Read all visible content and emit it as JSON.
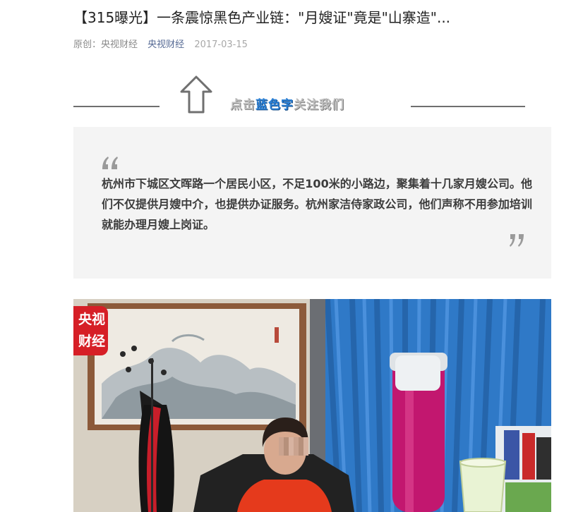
{
  "article": {
    "title": "【315曝光】一条震惊黑色产业链：\"月嫂证\"竟是\"山寨造\"...",
    "author": "原创：央视财经",
    "account": "央视财经",
    "date": "2017-03-15"
  },
  "follow_banner": {
    "prefix": "点击",
    "highlight": "蓝色字",
    "suffix": "关注我们",
    "icon": "up-arrow-icon"
  },
  "quote": {
    "text": "杭州市下城区文晖路一个居民小区，不足100米的小路边，聚集着十几家月嫂公司。他们不仅提供月嫂中介，也提供办证服务。杭州家洁侍家政公司，他们声称不用参加培训就能办理月嫂上岗证。",
    "open_icon": "open-quote-icon",
    "close_icon": "close-quote-icon"
  },
  "video": {
    "logo_line1": "央视",
    "logo_line2": "财经",
    "colors": {
      "logo": "#d61f26",
      "curtain": "#2f79c7",
      "thermos": "#c2176f",
      "jacket": "#e53a1c"
    }
  },
  "colors": {
    "account_link": "#576b95",
    "highlight": "#2a7fd4"
  }
}
